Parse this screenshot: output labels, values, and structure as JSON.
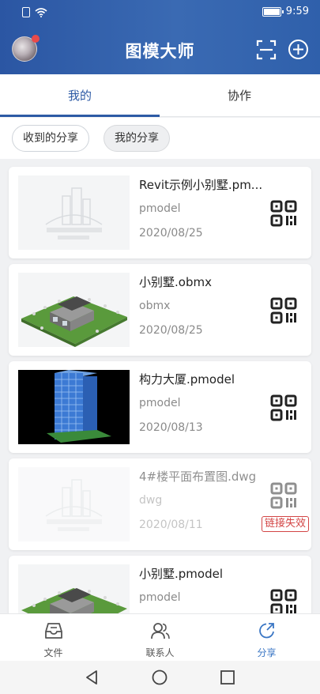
{
  "status_bar": {
    "time": "9:59"
  },
  "header": {
    "title": "图模大师",
    "icons": [
      "avatar",
      "scan-icon",
      "add-icon"
    ]
  },
  "tabs": [
    {
      "label": "我的",
      "active": true
    },
    {
      "label": "协作",
      "active": false
    }
  ],
  "filters": [
    {
      "label": "收到的分享",
      "active": true
    },
    {
      "label": "我的分享",
      "active": false
    }
  ],
  "files": [
    {
      "name": "Revit示例小别墅.pm...",
      "type": "pmodel",
      "date": "2020/08/25",
      "thumb": "placeholder",
      "status": ""
    },
    {
      "name": "小别墅.obmx",
      "type": "obmx",
      "date": "2020/08/25",
      "thumb": "villa",
      "status": ""
    },
    {
      "name": "构力大厦.pmodel",
      "type": "pmodel",
      "date": "2020/08/13",
      "thumb": "tower",
      "status": ""
    },
    {
      "name": "4#楼平面布置图.dwg",
      "type": "dwg",
      "date": "2020/08/11",
      "thumb": "placeholder",
      "status": "链接失效"
    },
    {
      "name": "小别墅.pmodel",
      "type": "pmodel",
      "date": "",
      "thumb": "villa",
      "status": ""
    }
  ],
  "bottom_nav": [
    {
      "label": "文件",
      "icon": "inbox-icon",
      "active": false
    },
    {
      "label": "联系人",
      "icon": "contacts-icon",
      "active": false
    },
    {
      "label": "分享",
      "icon": "share-icon",
      "active": true
    }
  ],
  "colors": {
    "header": "#2b56a3",
    "accent": "#2d5aa5",
    "share_active": "#3a76c4",
    "expired": "#d34545"
  }
}
